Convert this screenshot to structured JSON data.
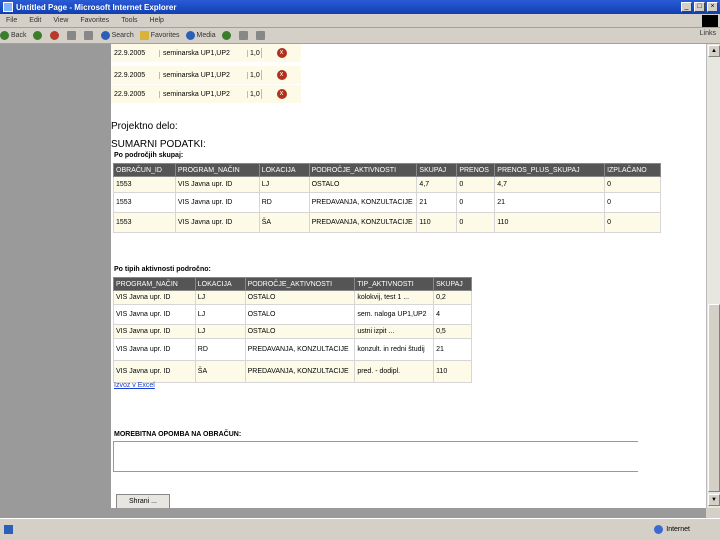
{
  "window": {
    "title": "Untitled Page - Microsoft Internet Explorer",
    "buttons": [
      "_",
      "□",
      "×"
    ]
  },
  "menu": [
    "File",
    "Edit",
    "View",
    "Favorites",
    "Tools",
    "Help"
  ],
  "toolbar": {
    "back": "Back",
    "search": "Search",
    "favorites": "Favorites",
    "media": "Media",
    "links": "Links"
  },
  "top_rows": [
    {
      "date": "22.9.2005",
      "type": "seminarska UP1,UP2",
      "value": "1,0"
    },
    {
      "date": "22.9.2005",
      "type": "seminarska UP1,UP2",
      "value": "1,0"
    },
    {
      "date": "22.9.2005",
      "type": "seminarska UP1,UP2",
      "value": "1,0"
    }
  ],
  "projektno_label": "Projektno delo:",
  "summary_title": "SUMARNI PODATKI:",
  "by_area": {
    "caption": "Po področjih skupaj:",
    "headers": [
      "OBRAČUN_ID",
      "PROGRAM_NAČIN",
      "LOKACIJA",
      "PODROČJE_AKTIVNOSTI",
      "SKUPAJ",
      "PRENOS",
      "PRENOS_PLUS_SKUPAJ",
      "IZPLAČANO"
    ],
    "rows": [
      [
        "1553",
        "VIS Javna upr. ID",
        "LJ",
        "OSTALO",
        "4,7",
        "0",
        "4,7",
        "0"
      ],
      [
        "1553",
        "VIS Javna upr. ID",
        "RD",
        "PREDAVANJA, KONZULTACIJE",
        "21",
        "0",
        "21",
        "0"
      ],
      [
        "1553",
        "VIS Javna upr. ID",
        "ŠA",
        "PREDAVANJA, KONZULTACIJE",
        "110",
        "0",
        "110",
        "0"
      ]
    ]
  },
  "by_type": {
    "caption": "Po tipih aktivnosti področno:",
    "headers": [
      "PROGRAM_NAČIN",
      "LOKACIJA",
      "PODROČJE_AKTIVNOSTI",
      "TIP_AKTIVNOSTI",
      "SKUPAJ"
    ],
    "rows": [
      [
        "VIS Javna upr. ID",
        "LJ",
        "OSTALO",
        "kolokvij, test 1 ...",
        "0,2"
      ],
      [
        "VIS Javna upr. ID",
        "LJ",
        "OSTALO",
        "sem. naloga UP1,UP2",
        "4"
      ],
      [
        "VIS Javna upr. ID",
        "LJ",
        "OSTALO",
        "ustni izpit ...",
        "0,5"
      ],
      [
        "VIS Javna upr. ID",
        "RD",
        "PREDAVANJA, KONZULTACIJE",
        "konzult. in redni študij",
        "21"
      ],
      [
        "VIS Javna upr. ID",
        "ŠA",
        "PREDAVANJA, KONZULTACIJE",
        "pred. - dodipl.",
        "110"
      ]
    ]
  },
  "excel_link": "Izvoz v Excel",
  "note_label": "MOREBITNA OPOMBA NA OBRAČUN:",
  "note_value": "",
  "save_button": "Shrani ...",
  "status": {
    "left": "",
    "zone": "Internet"
  }
}
